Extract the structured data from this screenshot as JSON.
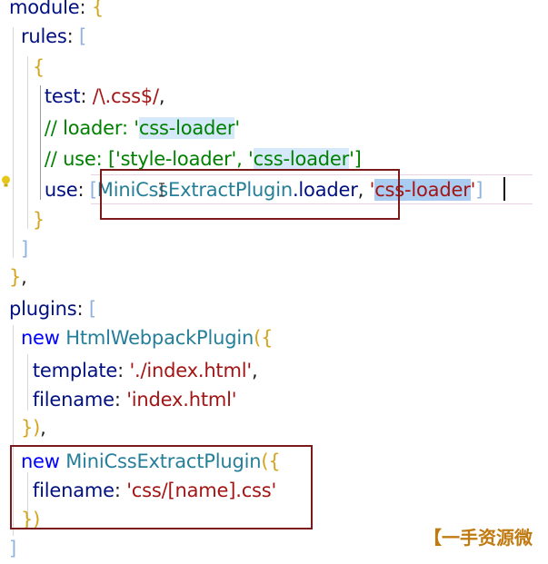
{
  "editor": {
    "lines": [
      [
        {
          "t": "module",
          "c": "key"
        },
        {
          "t": ": ",
          "c": "punct"
        },
        {
          "t": "{",
          "c": "brace"
        }
      ],
      [
        {
          "t": "  rules",
          "c": "key"
        },
        {
          "t": ": ",
          "c": "punct"
        },
        {
          "t": "[",
          "c": "bracket"
        }
      ],
      [
        {
          "t": "    {",
          "c": "brace"
        }
      ],
      [
        {
          "t": "      test",
          "c": "key"
        },
        {
          "t": ": ",
          "c": "punct"
        },
        {
          "t": "/\\.css$/",
          "c": "regex"
        },
        {
          "t": ",",
          "c": "punct"
        }
      ],
      [
        {
          "t": "      // loader: 'css-loader'",
          "c": "comment"
        }
      ],
      [
        {
          "t": "      // use: ['style-loader', 'css-loader']",
          "c": "comment"
        }
      ],
      [
        {
          "t": "      use",
          "c": "key"
        },
        {
          "t": ": ",
          "c": "punct"
        },
        {
          "t": "[",
          "c": "bracket"
        },
        {
          "t": "MiniCssExtractPlugin",
          "c": "class"
        },
        {
          "t": ".loader",
          "c": "key"
        },
        {
          "t": ", ",
          "c": "punct"
        },
        {
          "t": "'css-loader'",
          "c": "string"
        },
        {
          "t": "]",
          "c": "bracket"
        }
      ],
      [
        {
          "t": "    }",
          "c": "brace"
        }
      ],
      [
        {
          "t": "  ]",
          "c": "bracket"
        }
      ],
      [
        {
          "t": "}",
          "c": "brace"
        },
        {
          "t": ",",
          "c": "punct"
        }
      ],
      [
        {
          "t": "plugins",
          "c": "key"
        },
        {
          "t": ": ",
          "c": "punct"
        },
        {
          "t": "[",
          "c": "bracket"
        }
      ],
      [
        {
          "t": "  new ",
          "c": "keyword"
        },
        {
          "t": "HtmlWebpackPlugin",
          "c": "class"
        },
        {
          "t": "(",
          "c": "paren"
        },
        {
          "t": "{",
          "c": "brace"
        }
      ],
      [
        {
          "t": "    template",
          "c": "key"
        },
        {
          "t": ": ",
          "c": "punct"
        },
        {
          "t": "'./index.html'",
          "c": "string"
        },
        {
          "t": ",",
          "c": "punct"
        }
      ],
      [
        {
          "t": "    filename",
          "c": "key"
        },
        {
          "t": ": ",
          "c": "punct"
        },
        {
          "t": "'index.html'",
          "c": "string"
        }
      ],
      [
        {
          "t": "  }",
          "c": "brace"
        },
        {
          "t": ")",
          "c": "paren"
        },
        {
          "t": ",",
          "c": "punct"
        }
      ],
      [
        {
          "t": "  new ",
          "c": "keyword"
        },
        {
          "t": "MiniCssExtractPlugin",
          "c": "class"
        },
        {
          "t": "(",
          "c": "paren"
        },
        {
          "t": "{",
          "c": "brace"
        }
      ],
      [
        {
          "t": "    filename",
          "c": "key"
        },
        {
          "t": ": ",
          "c": "punct"
        },
        {
          "t": "'css/[name].css'",
          "c": "string"
        }
      ],
      [
        {
          "t": "  }",
          "c": "brace"
        },
        {
          "t": ")",
          "c": "paren"
        }
      ],
      [
        {
          "t": "]",
          "c": "bracket"
        }
      ]
    ]
  },
  "watermark": {
    "text": "【一手资源微"
  },
  "colors": {
    "annotation_box": "#7a1a1a",
    "comment": "#008000",
    "string": "#a31515",
    "keyword": "#0000ff",
    "class": "#267f99",
    "property": "#001080"
  }
}
